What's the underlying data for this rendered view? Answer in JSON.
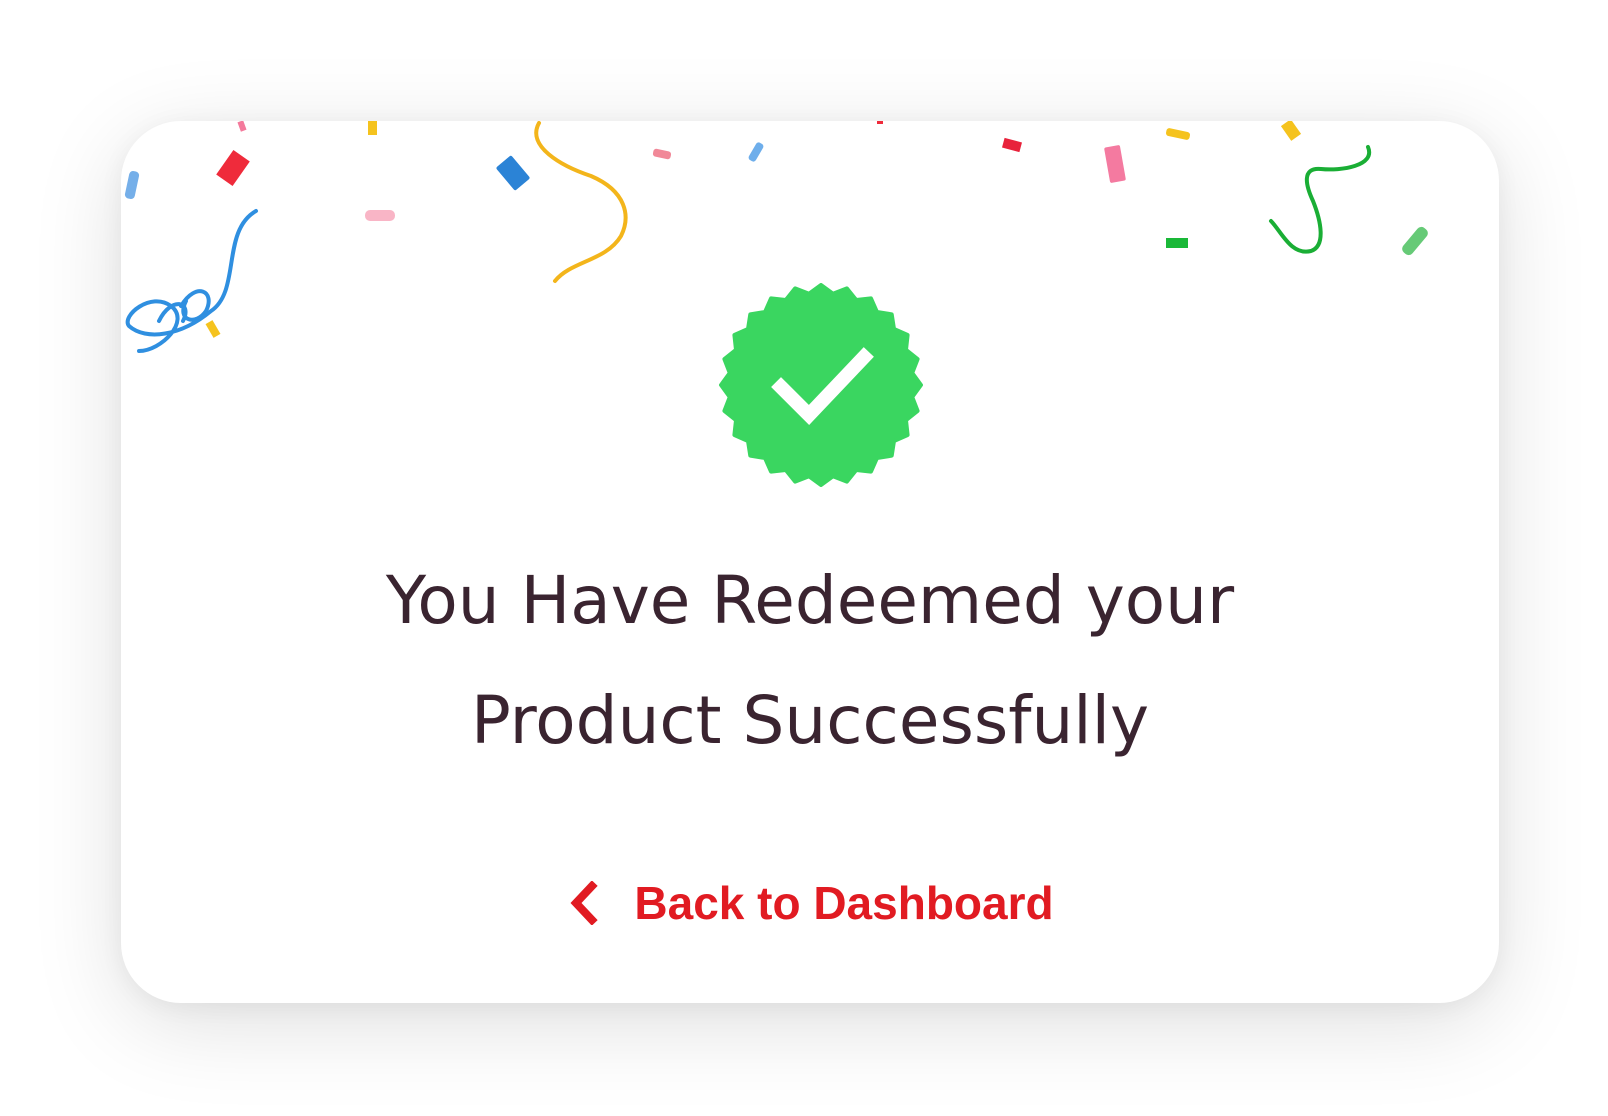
{
  "dialog": {
    "message_line1": "You Have Redeemed your",
    "message_line2": "Product Successfully",
    "back_link_label": "Back to Dashboard",
    "badge_icon": "verified-check-badge-icon",
    "back_icon": "chevron-left-icon",
    "decoration": "confetti-streamers"
  },
  "colors": {
    "badge": "#3ad660",
    "check": "#ffffff",
    "message_text": "#3a2430",
    "link": "#e11b22",
    "card_background": "#ffffff"
  }
}
